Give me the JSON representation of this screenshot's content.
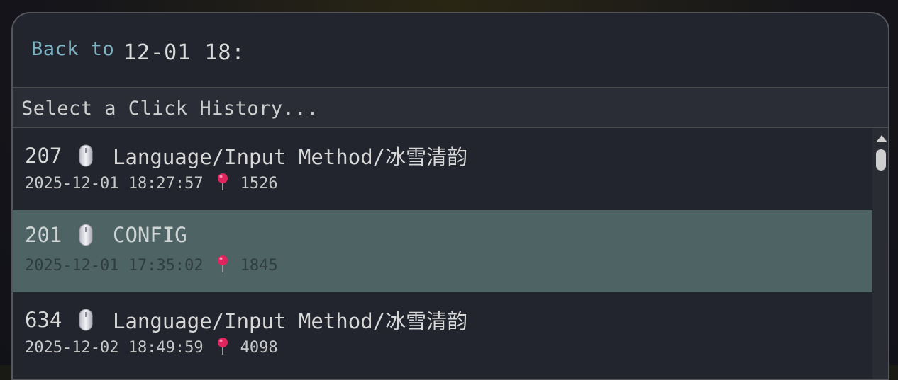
{
  "header": {
    "back_label": "Back to",
    "date_value": "12-01 18:"
  },
  "search": {
    "placeholder": "Select a Click History..."
  },
  "items": [
    {
      "id": "207",
      "icon": "mouse-icon",
      "label": "Language/Input Method/冰雪清韵",
      "timestamp": "2025-12-01 18:27:57",
      "pin_icon": "pin-icon",
      "count": "1526",
      "selected": false
    },
    {
      "id": "201",
      "icon": "mouse-icon",
      "label": "CONFIG",
      "timestamp": "2025-12-01 17:35:02",
      "pin_icon": "pin-icon",
      "count": "1845",
      "selected": true
    },
    {
      "id": "634",
      "icon": "mouse-icon",
      "label": "Language/Input Method/冰雪清韵",
      "timestamp": "2025-12-02 18:49:59",
      "pin_icon": "pin-icon",
      "count": "4098",
      "selected": false
    }
  ],
  "colors": {
    "accent_link": "#7eb3c3",
    "selected_bg": "#4d6364",
    "panel_bg": "#22252e",
    "pin": "#e0245e"
  }
}
